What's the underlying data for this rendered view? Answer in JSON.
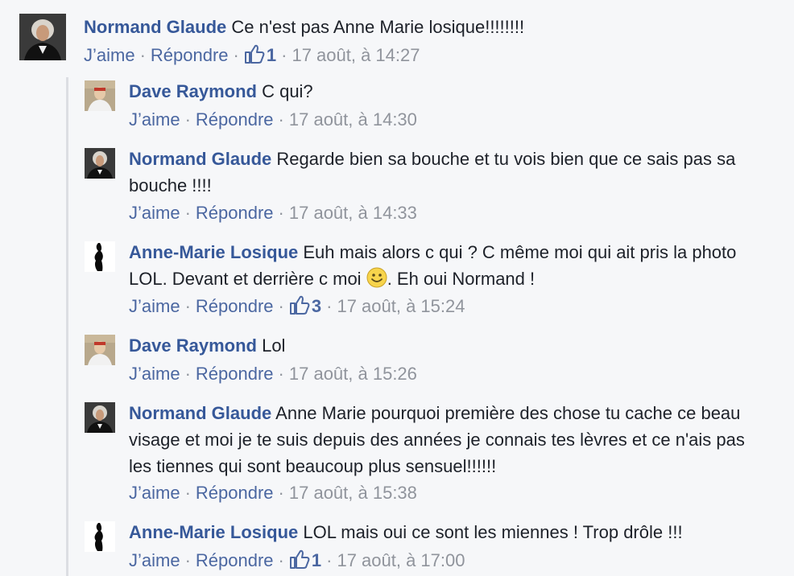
{
  "labels": {
    "like": "J’aime",
    "reply": "Répondre",
    "sep": "·"
  },
  "comments": [
    {
      "author": "Normand Glaude",
      "text": "Ce n'est pas Anne Marie losique!!!!!!!!",
      "likes": "1",
      "time": "17 août, à 14:27",
      "avatar": "avatar-normand"
    },
    {
      "author": "Dave Raymond",
      "text": "C qui?",
      "time": "17 août, à 14:30",
      "avatar": "avatar-dave"
    },
    {
      "author": "Normand Glaude",
      "text": "Regarde bien sa bouche et tu vois bien que ce sais pas sa bouche !!!!",
      "time": "17 août, à 14:33",
      "avatar": "avatar-normand"
    },
    {
      "author": "Anne-Marie Losique",
      "text_a": "Euh mais alors c qui ? C même moi qui ait pris la photo LOL. Devant et derrière c moi",
      "text_b": ". Eh oui Normand !",
      "emoji": "smiley-emoji",
      "likes": "3",
      "time": "17 août, à 15:24",
      "avatar": "avatar-anne-marie"
    },
    {
      "author": "Dave Raymond",
      "text": "Lol",
      "time": "17 août, à 15:26",
      "avatar": "avatar-dave"
    },
    {
      "author": "Normand Glaude",
      "text": "Anne Marie pourquoi première des chose tu cache ce beau visage et moi je te suis depuis des années je connais tes lèvres et ce n'ais pas les tiennes qui sont beaucoup plus sensuel!!!!!!",
      "time": "17 août, à 15:38",
      "avatar": "avatar-normand"
    },
    {
      "author": "Anne-Marie Losique",
      "text": "LOL mais oui ce sont les miennes ! Trop drôle !!!",
      "likes": "1",
      "time": "17 août, à 17:00",
      "avatar": "avatar-anne-marie"
    }
  ],
  "colors": {
    "author": "#365899",
    "link": "#4b67a1",
    "meta": "#90949c",
    "text": "#1d2129",
    "background": "#f6f7f9"
  },
  "icons": [
    "thumbs-up-icon",
    "smiley-emoji"
  ]
}
